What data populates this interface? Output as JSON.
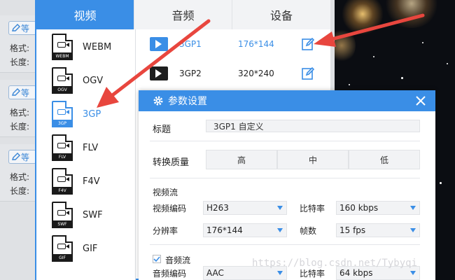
{
  "background": {
    "cards": [
      {
        "edit_label": "等",
        "format_label": "格式:",
        "length_label": "长度:"
      },
      {
        "edit_label": "等",
        "format_label": "格式:",
        "length_label": "长度:"
      },
      {
        "edit_label": "等",
        "format_label": "格式:",
        "length_label": "长度:"
      }
    ]
  },
  "category_tabs": [
    {
      "label": "视频",
      "active": true
    },
    {
      "label": "音频",
      "active": false
    },
    {
      "label": "设备",
      "active": false
    }
  ],
  "formats": [
    {
      "name": "WEBM",
      "tag": "WEBM",
      "active": false
    },
    {
      "name": "OGV",
      "tag": "OGV",
      "active": false
    },
    {
      "name": "3GP",
      "tag": "3GP",
      "active": true
    },
    {
      "name": "FLV",
      "tag": "FLV",
      "active": false
    },
    {
      "name": "F4V",
      "tag": "F4V",
      "active": false
    },
    {
      "name": "SWF",
      "tag": "SWF",
      "active": false
    },
    {
      "name": "GIF",
      "tag": "GIF",
      "active": false
    }
  ],
  "presets": [
    {
      "name": "3GP1",
      "resolution": "176*144",
      "active": true
    },
    {
      "name": "3GP2",
      "resolution": "320*240",
      "active": false
    }
  ],
  "dialog": {
    "title": "参数设置",
    "title_label": "标题",
    "title_value": "3GP1 自定义",
    "quality_label": "转换质量",
    "quality_options": [
      "高",
      "中",
      "低"
    ],
    "video_section": "视频流",
    "video_codec_label": "视频编码",
    "video_codec_value": "H263",
    "video_bitrate_label": "比特率",
    "video_bitrate_value": "160 kbps",
    "resolution_label": "分辨率",
    "resolution_value": "176*144",
    "fps_label": "帧数",
    "fps_value": "15 fps",
    "audio_section": "音频流",
    "audio_enabled": true,
    "audio_codec_label": "音频编码",
    "audio_codec_value": "AAC",
    "audio_bitrate_label": "比特率",
    "audio_bitrate_value": "64 kbps"
  },
  "watermark": "https://blog.csdn.net/Tybyqi",
  "colors": {
    "accent": "#3a8ee6",
    "annotation_arrow": "#e8463e"
  }
}
